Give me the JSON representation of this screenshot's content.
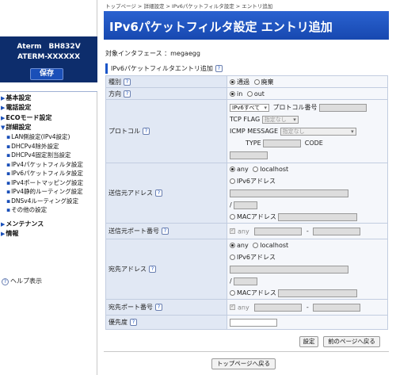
{
  "sidebar": {
    "model_line1": "Aterm　BH832V",
    "model_line2": "ATERM-XXXXXX",
    "save_label": "保存",
    "menu": [
      {
        "label": "基本設定",
        "type": "top"
      },
      {
        "label": "電話設定",
        "type": "top"
      },
      {
        "label": "ECOモード設定",
        "type": "top"
      },
      {
        "label": "詳細設定",
        "type": "top"
      },
      {
        "label": "LAN側設定(IPv4設定)",
        "type": "sub"
      },
      {
        "label": "DHCPv4除外設定",
        "type": "sub"
      },
      {
        "label": "DHCPv4固定割当設定",
        "type": "sub"
      },
      {
        "label": "IPv4パケットフィルタ設定",
        "type": "sub"
      },
      {
        "label": "IPv6パケットフィルタ設定",
        "type": "sub"
      },
      {
        "label": "IPv4ポートマッピング設定",
        "type": "sub"
      },
      {
        "label": "IPv4静的ルーティング設定",
        "type": "sub"
      },
      {
        "label": "DNSv4ルーティング設定",
        "type": "sub"
      },
      {
        "label": "その他の設定",
        "type": "sub"
      },
      {
        "label": "メンテナンス",
        "type": "top"
      },
      {
        "label": "情報",
        "type": "top"
      }
    ],
    "help_label": "ヘルプ表示"
  },
  "breadcrumb": "トップページ > 詳細設定 > IPv6パケットフィルタ設定 > エントリ追加",
  "page_title": "IPv6パケットフィルタ設定 エントリ追加",
  "interface_line": "対象インタフェース ：megaegg",
  "section_title": "IPv6パケットフィルタエントリ追加",
  "help_icon_char": "?",
  "form": {
    "type_label": "種別",
    "type_options": [
      "通過",
      "廃棄"
    ],
    "direction_label": "方向",
    "direction_options": [
      "in",
      "out"
    ],
    "protocol_label": "プロトコル",
    "protocol_select": "IPv6すべて",
    "protocol_number_label": "プロトコル番号",
    "tcp_flag_label": "TCP FLAG",
    "tcp_flag_value": "指定なし",
    "icmp_label": "ICMP MESSAGE",
    "icmp_value": "指定なし",
    "icmp_type_label": "TYPE",
    "icmp_code_label": "CODE",
    "src_addr_label": "送信元アドレス",
    "src_port_label": "送信元ポート番号",
    "dst_addr_label": "宛先アドレス",
    "dst_port_label": "宛先ポート番号",
    "priority_label": "優先度",
    "addr_options": [
      "any",
      "localhost",
      "IPv6アドレス",
      "MACアドレス"
    ],
    "slash": "/",
    "port_any": "any",
    "dash": "-"
  },
  "buttons": {
    "set": "設定",
    "back": "前のページへ戻る",
    "top": "トップページへ戻る"
  }
}
